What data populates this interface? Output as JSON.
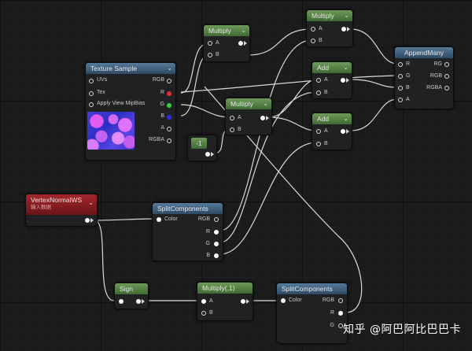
{
  "nodes": {
    "texture_sample": {
      "title": "Texture Sample",
      "inputs": [
        "UVs",
        "Tex",
        "Apply View MipBias"
      ],
      "outputs": [
        "RGB",
        "R",
        "G",
        "B",
        "A",
        "RGBA"
      ]
    },
    "multiply_1": {
      "title": "Multiply",
      "inputs": [
        "A",
        "B"
      ]
    },
    "multiply_2": {
      "title": "Multiply",
      "inputs": [
        "A",
        "B"
      ]
    },
    "multiply_3": {
      "title": "Multiply",
      "inputs": [
        "A",
        "B"
      ]
    },
    "add_1": {
      "title": "Add",
      "inputs": [
        "A",
        "B"
      ]
    },
    "add_2": {
      "title": "Add",
      "inputs": [
        "A",
        "B"
      ]
    },
    "constant": {
      "value": "-1"
    },
    "append_many": {
      "title": "AppendMany",
      "inputs": [
        "R",
        "G",
        "B",
        "A"
      ],
      "outputs": [
        "RG",
        "RGB",
        "RGBA"
      ]
    },
    "vertex_normal": {
      "title": "VertexNormalWS",
      "subtitle": "输入数据"
    },
    "split_1": {
      "title": "SplitComponents",
      "inputs": [
        "Color"
      ],
      "outputs": [
        "RGB",
        "R",
        "G",
        "B"
      ]
    },
    "sign": {
      "title": "Sign"
    },
    "multiply_neg": {
      "title": "Multiply(,1)",
      "inputs": [
        "A",
        "B"
      ]
    },
    "split_2": {
      "title": "SplitComponents",
      "inputs": [
        "Color"
      ],
      "outputs": [
        "RGB",
        "R",
        "G"
      ]
    }
  },
  "watermark": "知乎 @阿巴阿比巴巴卡",
  "colors": {
    "background": "#1b1b1b",
    "grid": "#262626",
    "wire": "#d9d9d9",
    "pin_r": "#e23030",
    "pin_g": "#3ad13a",
    "pin_b": "#2f2fe6"
  },
  "icons": [
    "chevron-down-icon",
    "pin-circle-icon",
    "exec-arrow-icon"
  ]
}
